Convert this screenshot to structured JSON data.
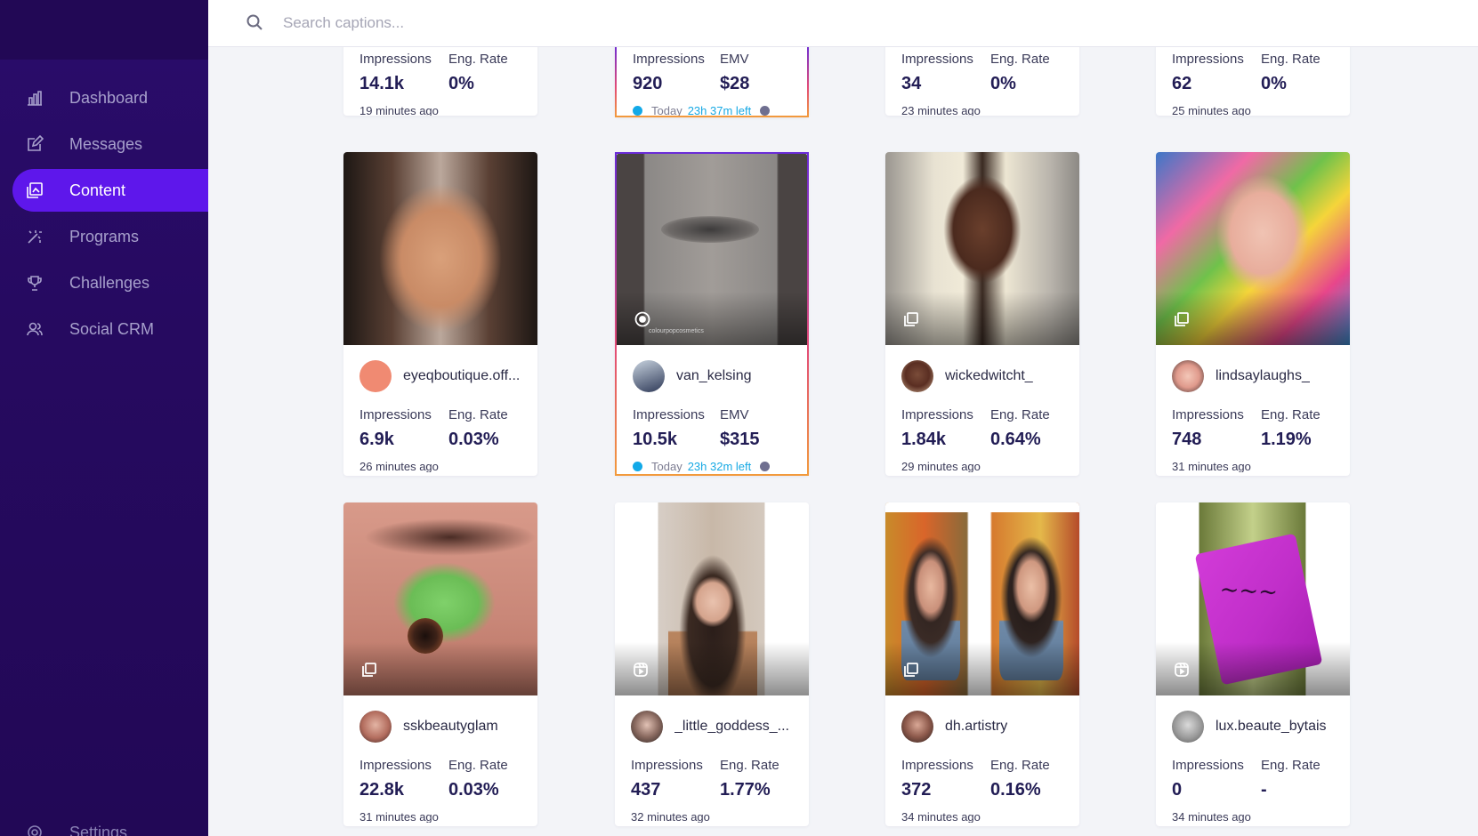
{
  "search": {
    "placeholder": "Search captions..."
  },
  "sidebar": {
    "items": [
      {
        "label": "Dashboard",
        "icon": "bar-chart-icon",
        "active": false
      },
      {
        "label": "Messages",
        "icon": "edit-icon",
        "active": false
      },
      {
        "label": "Content",
        "icon": "gallery-icon",
        "active": true
      },
      {
        "label": "Programs",
        "icon": "sparkle-icon",
        "active": false
      },
      {
        "label": "Challenges",
        "icon": "trophy-icon",
        "active": false
      },
      {
        "label": "Social CRM",
        "icon": "users-icon",
        "active": false
      }
    ],
    "settings_label": "Settings"
  },
  "top_cards": [
    {
      "labels": [
        "Impressions",
        "Eng. Rate"
      ],
      "values": [
        "14.1k",
        "0%"
      ],
      "time": "19 minutes ago"
    },
    {
      "labels": [
        "Impressions",
        "EMV"
      ],
      "values": [
        "920",
        "$28"
      ],
      "today": "Today",
      "left": "23h 37m left"
    },
    {
      "labels": [
        "Impressions",
        "Eng. Rate"
      ],
      "values": [
        "34",
        "0%"
      ],
      "time": "23 minutes ago"
    },
    {
      "labels": [
        "Impressions",
        "Eng. Rate"
      ],
      "values": [
        "62",
        "0%"
      ],
      "time": "25 minutes ago"
    }
  ],
  "cards": [
    {
      "username": "eyeqboutique.off...",
      "labels": [
        "Impressions",
        "Eng. Rate"
      ],
      "values": [
        "6.9k",
        "0.03%"
      ],
      "time": "26 minutes ago",
      "media": "none"
    },
    {
      "username": "van_kelsing",
      "labels": [
        "Impressions",
        "EMV"
      ],
      "values": [
        "10.5k",
        "$315"
      ],
      "today": "Today",
      "left": "23h 32m left",
      "media": "video",
      "watermark": "colourpopcosmetics"
    },
    {
      "username": "wickedwitcht_",
      "labels": [
        "Impressions",
        "Eng. Rate"
      ],
      "values": [
        "1.84k",
        "0.64%"
      ],
      "time": "29 minutes ago",
      "media": "carousel"
    },
    {
      "username": "lindsaylaughs_",
      "labels": [
        "Impressions",
        "Eng. Rate"
      ],
      "values": [
        "748",
        "1.19%"
      ],
      "time": "31 minutes ago",
      "media": "carousel"
    },
    {
      "username": "sskbeautyglam",
      "labels": [
        "Impressions",
        "Eng. Rate"
      ],
      "values": [
        "22.8k",
        "0.03%"
      ],
      "time": "31 minutes ago",
      "media": "carousel"
    },
    {
      "username": "_little_goddess_...",
      "labels": [
        "Impressions",
        "Eng. Rate"
      ],
      "values": [
        "437",
        "1.77%"
      ],
      "time": "32 minutes ago",
      "media": "reel"
    },
    {
      "username": "dh.artistry",
      "labels": [
        "Impressions",
        "Eng. Rate"
      ],
      "values": [
        "372",
        "0.16%"
      ],
      "time": "34 minutes ago",
      "media": "carousel"
    },
    {
      "username": "lux.beaute_bytais",
      "labels": [
        "Impressions",
        "Eng. Rate"
      ],
      "values": [
        "0",
        "-"
      ],
      "time": "34 minutes ago",
      "media": "reel"
    }
  ],
  "colors": {
    "sidebar": "#260a60",
    "active": "#5e17eb",
    "accent": "#17a9e4"
  }
}
